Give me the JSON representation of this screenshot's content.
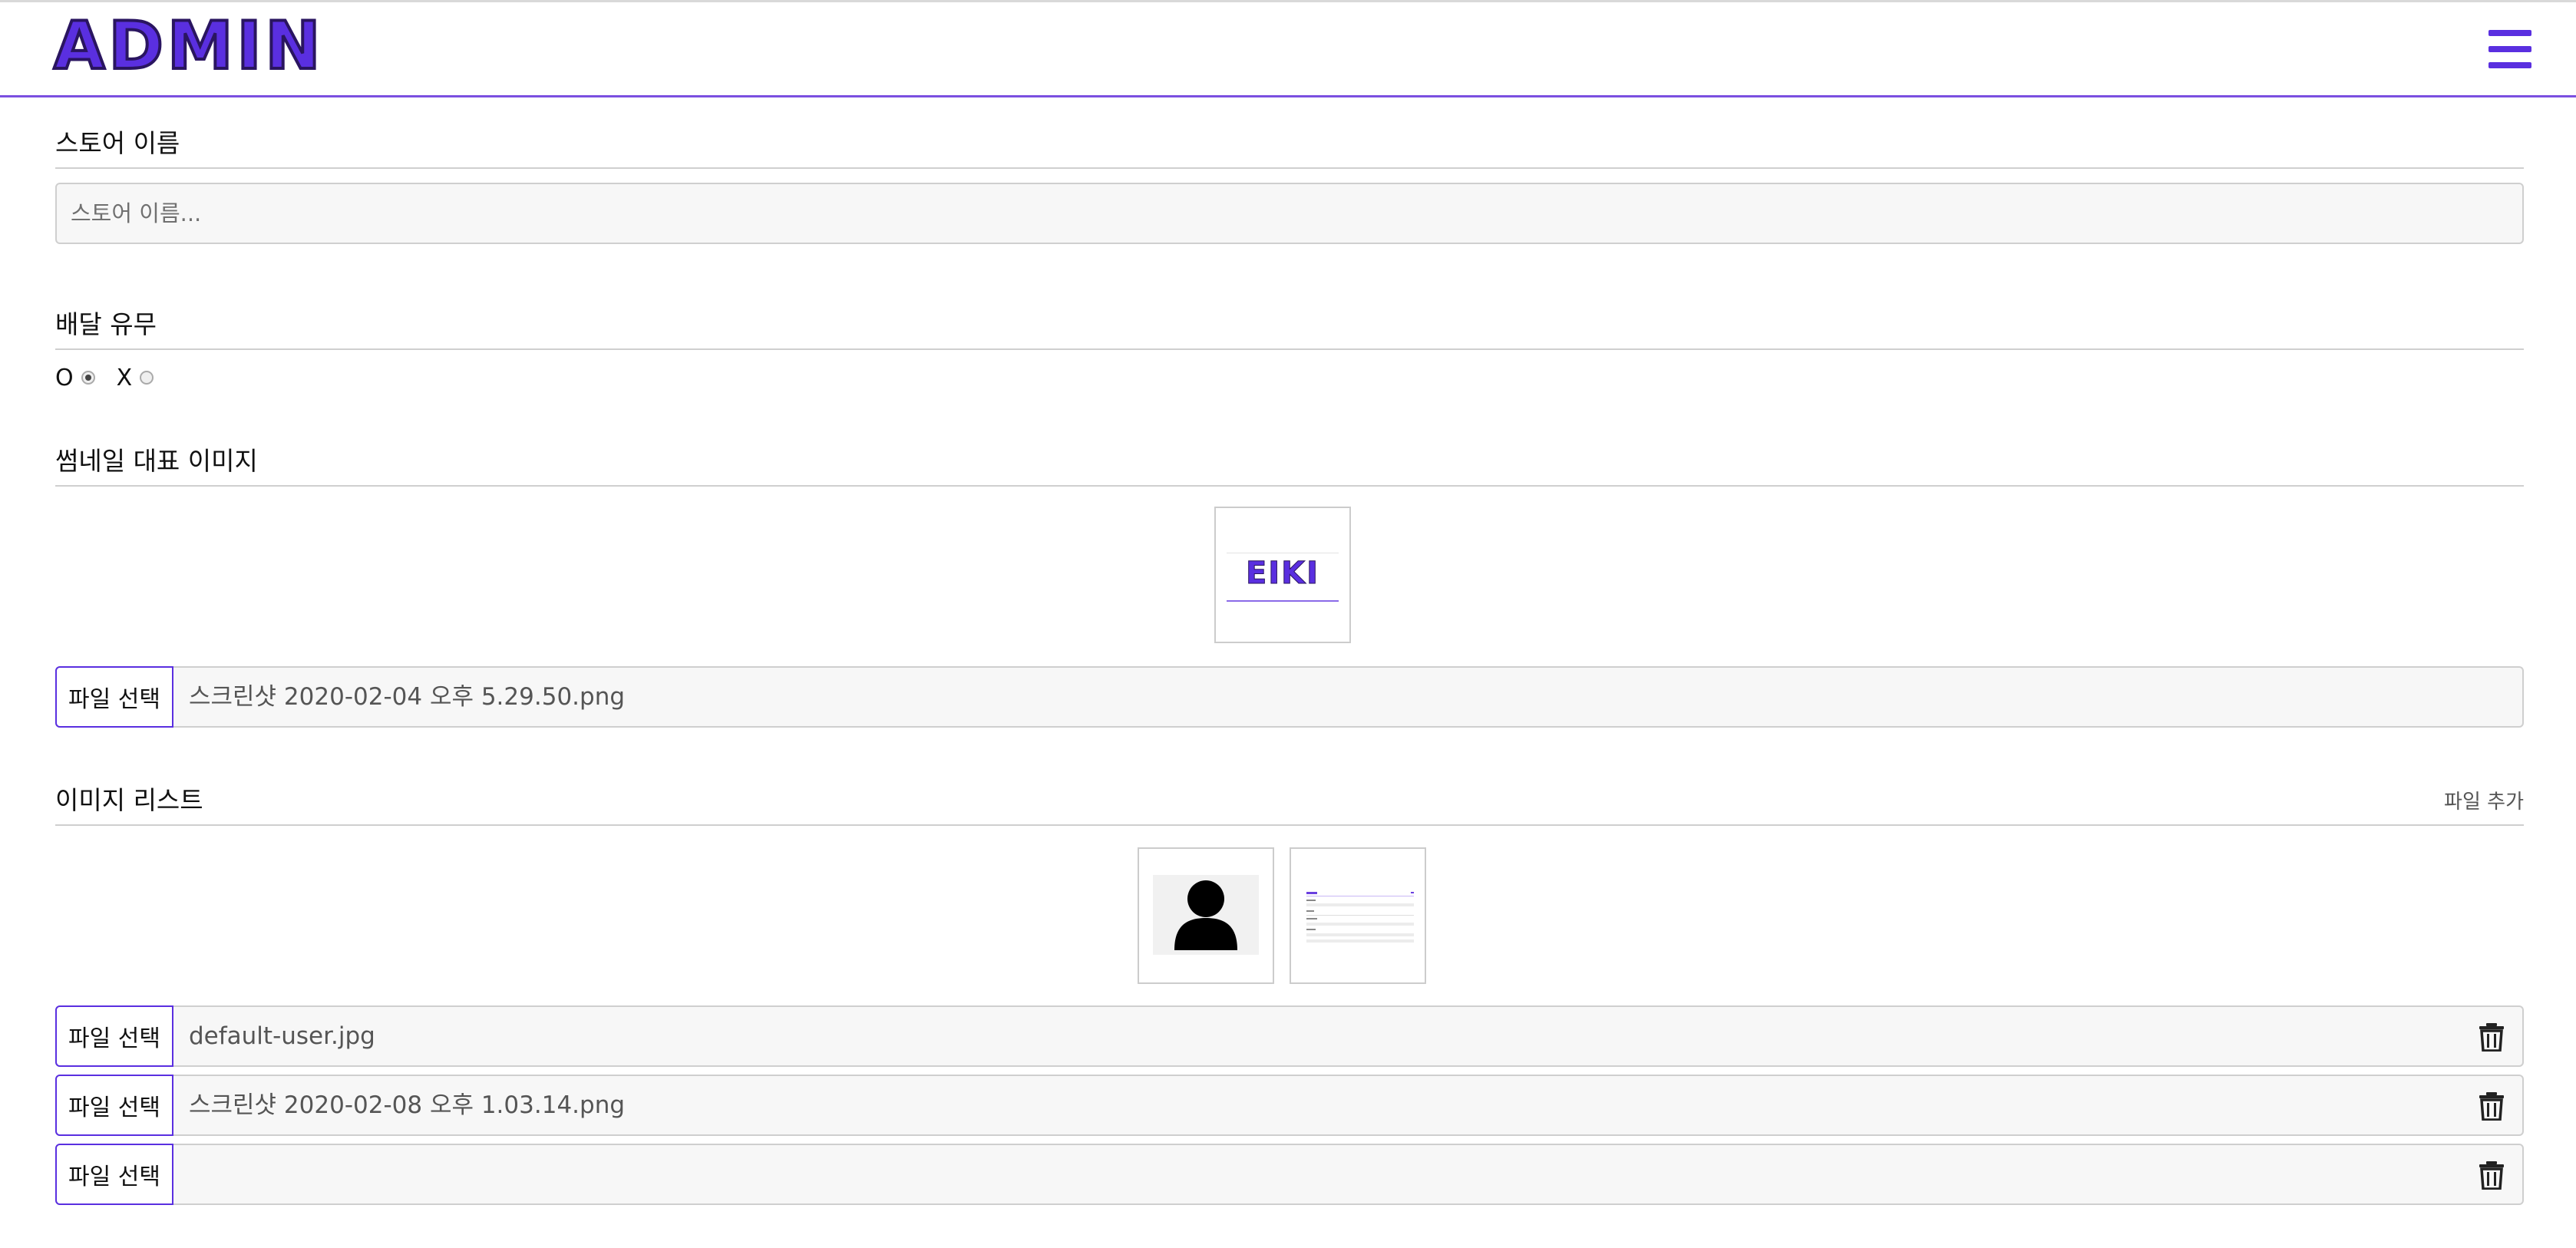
{
  "header": {
    "logo": "ADMIN",
    "menu_icon": "hamburger-menu-icon",
    "accent_color": "#5a2fe0"
  },
  "store_name": {
    "label": "스토어 이름",
    "value": "",
    "placeholder": "스토어 이름..."
  },
  "delivery": {
    "label": "배달 유무",
    "options": [
      {
        "label": "O",
        "checked": true
      },
      {
        "label": "X",
        "checked": false
      }
    ]
  },
  "thumbnail": {
    "label": "썸네일 대표 이미지",
    "preview_text": "EIKI",
    "file_button": "파일 선택",
    "file_name": "스크린샷 2020-02-04 오후 5.29.50.png"
  },
  "image_list": {
    "label": "이미지 리스트",
    "add_link": "파일 추가",
    "previews": [
      "user-silhouette-image",
      "screenshot-thumbnail-image"
    ],
    "files": [
      {
        "button": "파일 선택",
        "name": "default-user.jpg",
        "delete_icon": "trash-icon"
      },
      {
        "button": "파일 선택",
        "name": "스크린샷 2020-02-08 오후 1.03.14.png",
        "delete_icon": "trash-icon"
      },
      {
        "button": "파일 선택",
        "name": "",
        "delete_icon": "trash-icon"
      }
    ]
  }
}
